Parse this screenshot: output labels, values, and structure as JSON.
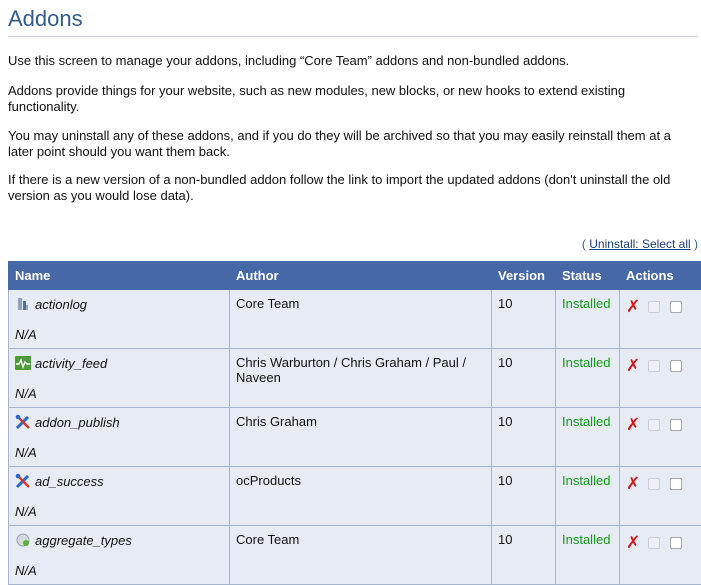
{
  "page": {
    "title": "Addons",
    "paragraphs": [
      "Use this screen to manage your addons, including “Core Team” addons and non-bundled addons.",
      "Addons provide things for your website, such as new modules, new blocks, or new hooks to extend existing functionality.",
      "You may uninstall any of these addons, and if you do they will be archived so that you may easily reinstall them at a later point should you want them back.",
      "If there is a new version of a non-bundled addon follow the link to import the updated addons (don't uninstall the old version as you would lose data)."
    ],
    "uninstall_prefix": "(",
    "uninstall_link": "Uninstall: Select all",
    "uninstall_suffix": ")"
  },
  "table": {
    "headers": {
      "name": "Name",
      "author": "Author",
      "version": "Version",
      "status": "Status",
      "actions": "Actions"
    },
    "rows": [
      {
        "name": "actionlog",
        "icon": "actionlog-icon",
        "description": "N/A",
        "author": "Core Team",
        "version": "10",
        "status": "Installed"
      },
      {
        "name": "activity_feed",
        "icon": "activity-feed-icon",
        "description": "N/A",
        "author": "Chris Warburton / Chris Graham / Paul / Naveen",
        "version": "10",
        "status": "Installed"
      },
      {
        "name": "addon_publish",
        "icon": "tools-icon",
        "description": "N/A",
        "author": "Chris Graham",
        "version": "10",
        "status": "Installed"
      },
      {
        "name": "ad_success",
        "icon": "tools-icon",
        "description": "N/A",
        "author": "ocProducts",
        "version": "10",
        "status": "Installed"
      },
      {
        "name": "aggregate_types",
        "icon": "aggregate-icon",
        "description": "N/A",
        "author": "Core Team",
        "version": "10",
        "status": "Installed"
      }
    ]
  },
  "colors": {
    "title": "#345b8c",
    "header_bg": "#4668a6",
    "row_bg": "#e7ecf4",
    "status_installed": "#129b19",
    "uninstall_x": "#d21c1c"
  }
}
